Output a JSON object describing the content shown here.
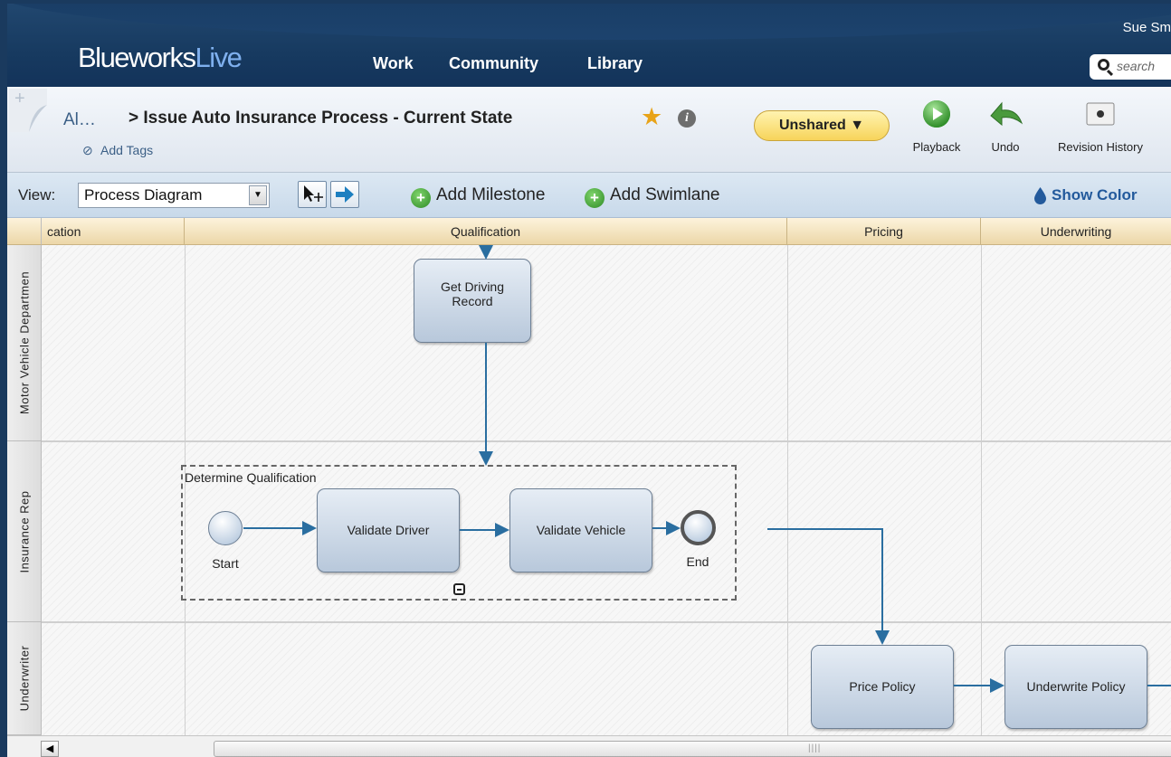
{
  "header": {
    "logo_main": "Blueworks",
    "logo_accent": "Live",
    "nav": [
      "Work",
      "Community",
      "Library"
    ],
    "user": "Sue Sm",
    "search_placeholder": "search"
  },
  "titlebar": {
    "breadcrumb": "Al…",
    "title": "> Issue Auto Insurance Process - Current State",
    "add_tags": "Add Tags",
    "share": "Unshared ▼",
    "tools": [
      "Playback",
      "Undo",
      "Revision History"
    ]
  },
  "toolbar": {
    "view_label": "View:",
    "view_value": "Process Diagram",
    "add_milestone": "Add Milestone",
    "add_swimlane": "Add Swimlane",
    "show_colors": "Show Color"
  },
  "diagram": {
    "milestones": [
      "cation",
      "Qualification",
      "Pricing",
      "Underwriting"
    ],
    "lanes": [
      "Motor Vehicle Departmen",
      "Insurance Rep",
      "Underwriter"
    ],
    "subprocess_label": "Determine Qualification",
    "tasks": {
      "get_driving_record": "Get Driving Record",
      "validate_driver": "Validate Driver",
      "validate_vehicle": "Validate Vehicle",
      "price_policy": "Price Policy",
      "underwrite_policy": "Underwrite Policy"
    },
    "events": {
      "start": "Start",
      "end": "End"
    }
  },
  "colors": {
    "connector": "#2a6ea0",
    "header_bg": "#173a60",
    "share_bg": "#f7d45a"
  }
}
